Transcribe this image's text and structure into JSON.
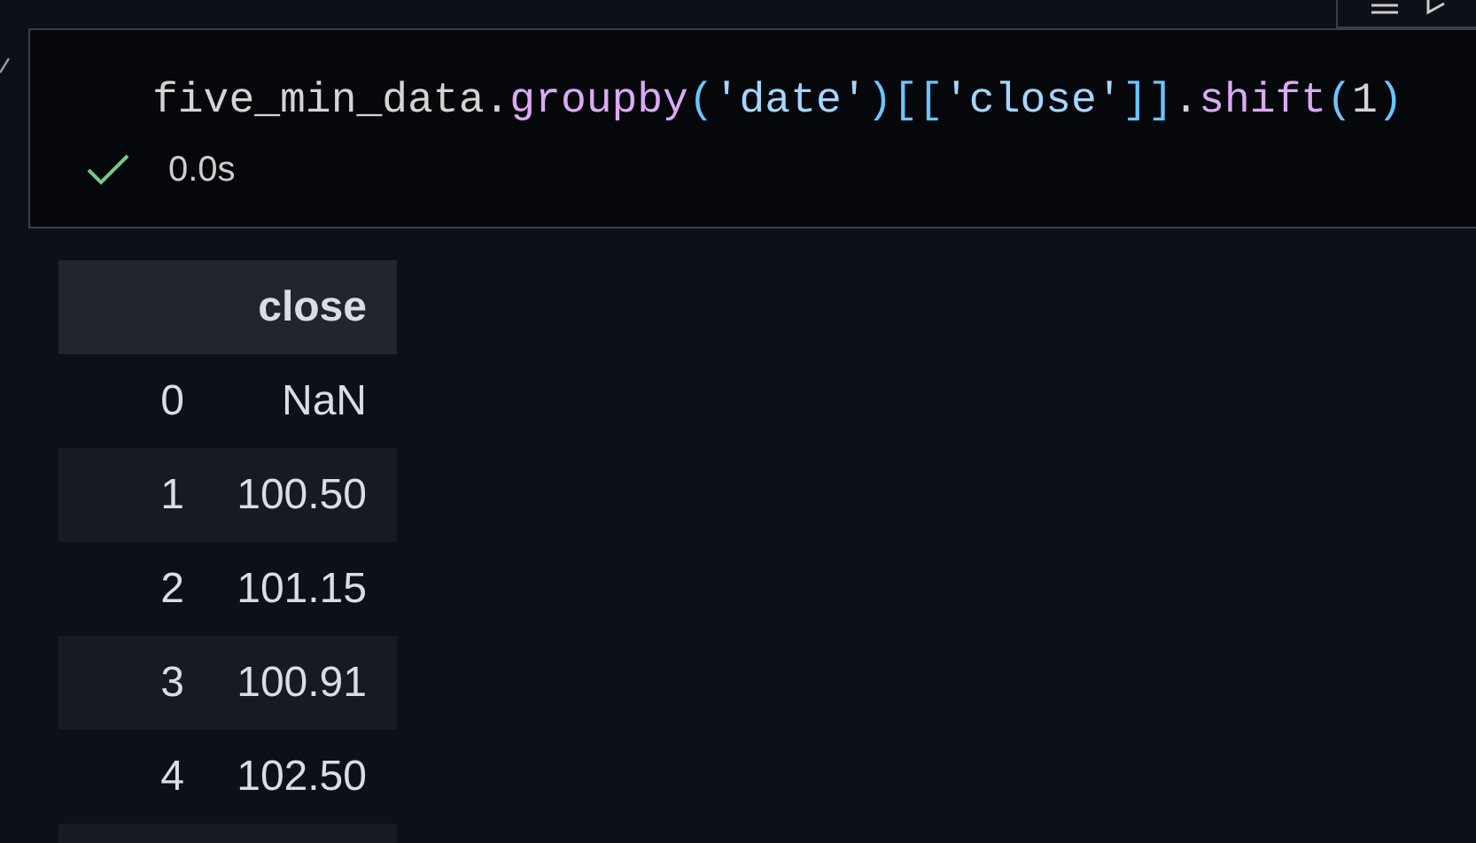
{
  "cell": {
    "code": [
      {
        "text": "five_min_data.",
        "kind": "plain"
      },
      {
        "text": "groupby",
        "kind": "method"
      },
      {
        "text": "(",
        "kind": "bracket"
      },
      {
        "text": "'date'",
        "kind": "string"
      },
      {
        "text": ")[[",
        "kind": "bracket"
      },
      {
        "text": "'close'",
        "kind": "string"
      },
      {
        "text": "]]",
        "kind": "bracket"
      },
      {
        "text": ".",
        "kind": "plain"
      },
      {
        "text": "shift",
        "kind": "method"
      },
      {
        "text": "(",
        "kind": "bracket"
      },
      {
        "text": "1",
        "kind": "plain"
      },
      {
        "text": ")",
        "kind": "bracket"
      }
    ],
    "status": {
      "success": true,
      "duration": "0.0s"
    }
  },
  "table": {
    "columns": [
      "close"
    ],
    "rows": [
      {
        "index": "0",
        "close": "NaN"
      },
      {
        "index": "1",
        "close": "100.50"
      },
      {
        "index": "2",
        "close": "101.15"
      },
      {
        "index": "3",
        "close": "100.91"
      },
      {
        "index": "4",
        "close": "102.50"
      }
    ]
  }
}
